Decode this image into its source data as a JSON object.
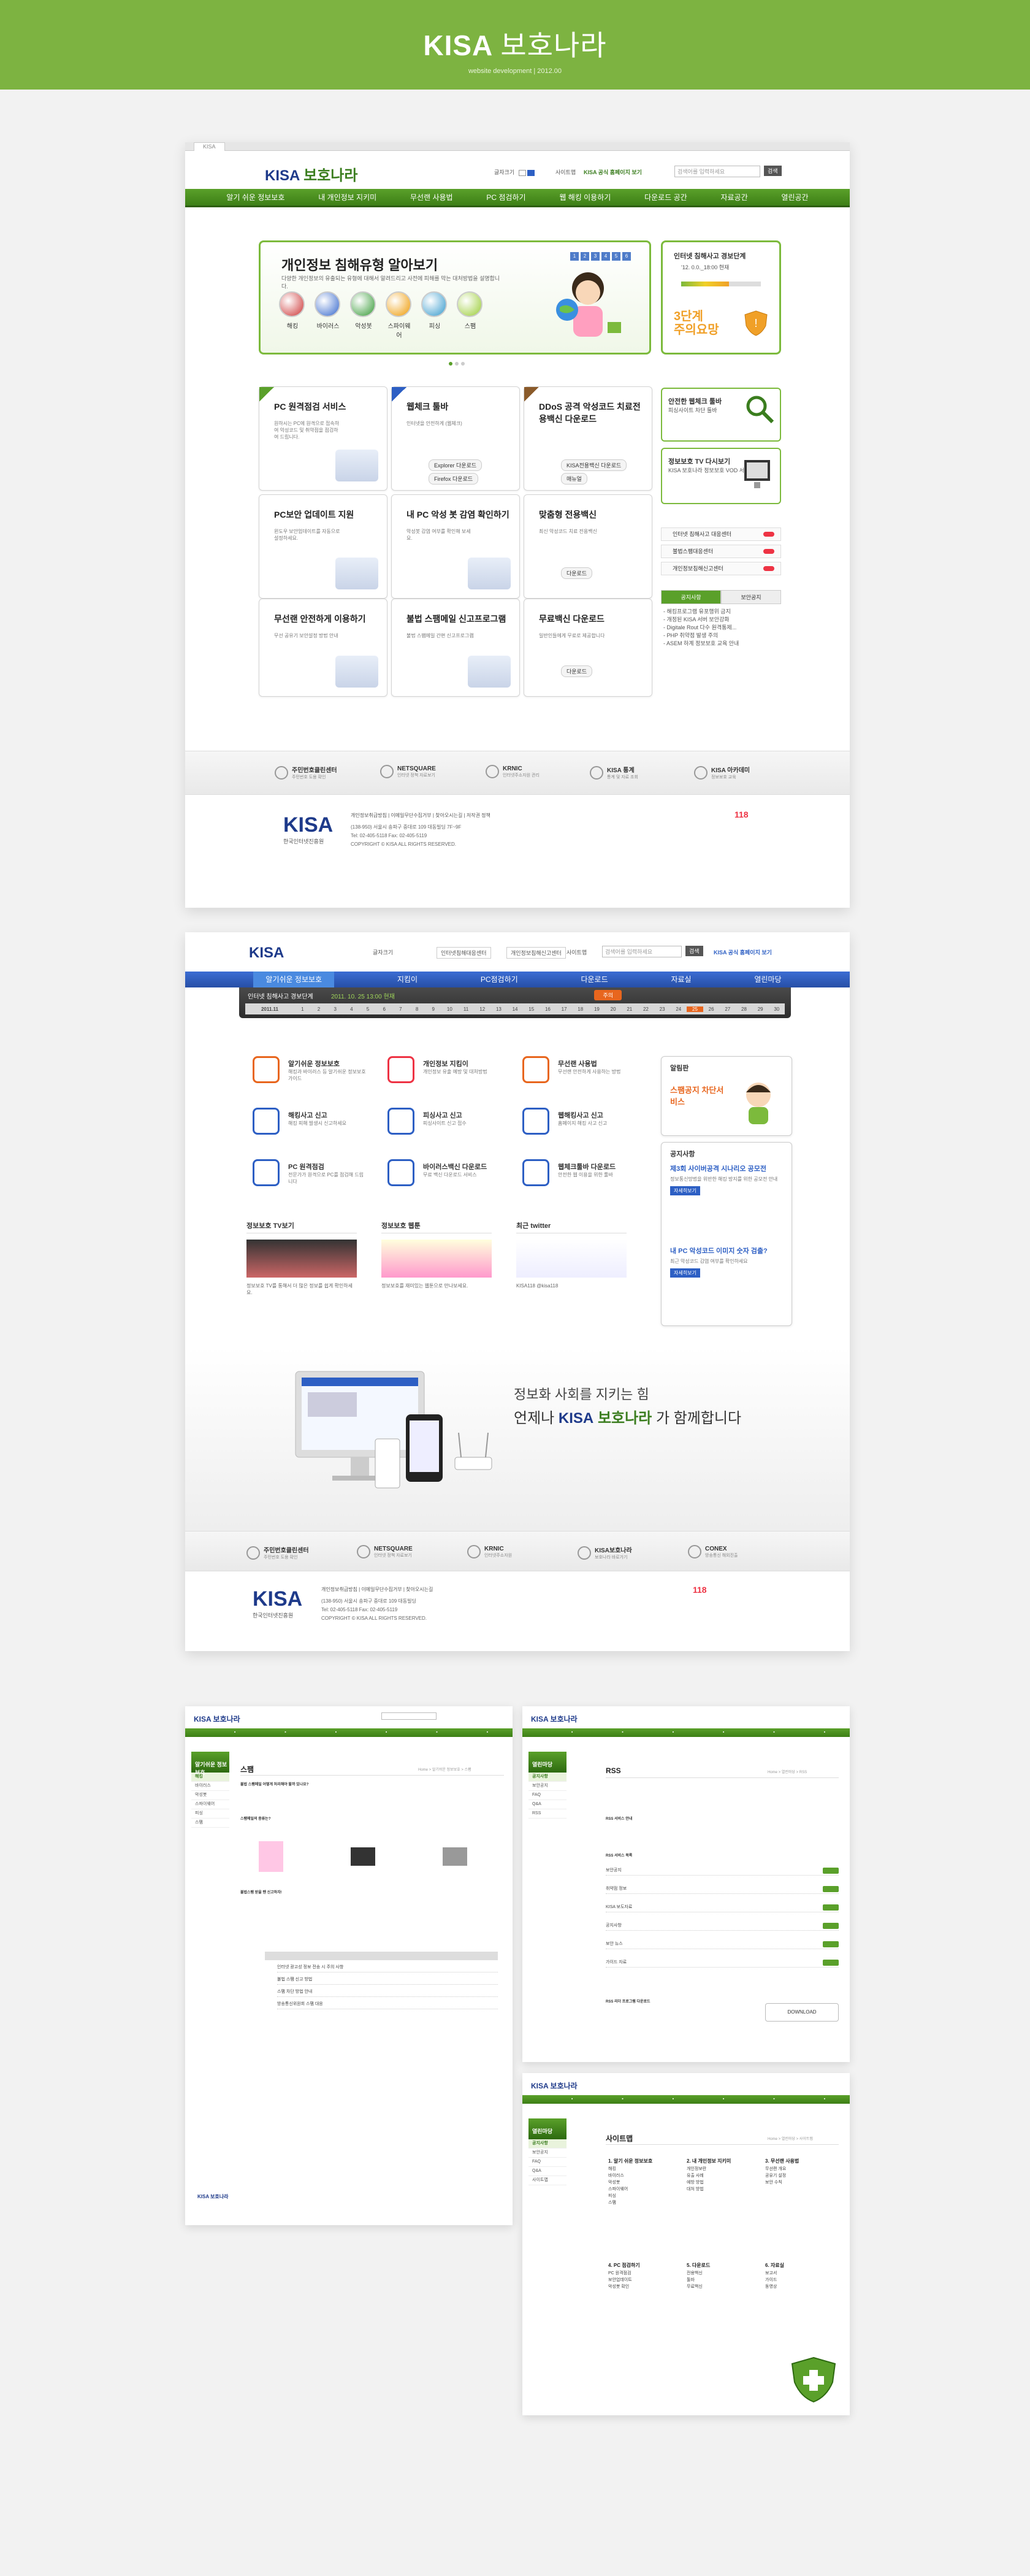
{
  "banner": {
    "title_brand": "KISA",
    "title_kr": "보호나라",
    "subtitle": "website development  |  2012.00"
  },
  "p1": {
    "tab": "KISA",
    "logo_brand": "KISA",
    "logo_kr": "보호나라",
    "font_size_label": "글자크기",
    "sitemap": "사이트맵",
    "kisa_link": "KISA 공식 홈페이지 보기",
    "search_placeholder": "검색어를 입력하세요",
    "search_btn": "검색",
    "gnb": [
      "알기 쉬운 정보보호",
      "내 개인정보 지키미",
      "무선랜 사용법",
      "PC 점검하기",
      "웹 해킹 이용하기",
      "다운로드 공간",
      "자료공간",
      "열린공간"
    ],
    "hero": {
      "title": "개인정보 침해유형 알아보기",
      "desc": "다양한 개인정보의 유출되는 유형에 대해서 알려드리고 사전에 피해를 막는 대처방법을 설명합니다.",
      "pager": [
        "1",
        "2",
        "3",
        "4",
        "5",
        "6"
      ],
      "icons": [
        "해킹",
        "바이러스",
        "악성봇",
        "스파이웨어",
        "피싱",
        "스팸"
      ]
    },
    "side": {
      "title": "인터넷 침해사고 경보단계",
      "desc": "'12. 0.0._18:00 현재",
      "level": "3단계",
      "level_sub": "주의요망"
    },
    "boxes": [
      {
        "title": "PC 원격점검 서비스",
        "desc": "원하시는 PC에 원격으로 접속하여 악성코드 및 취약점을 점검하여 드립니다."
      },
      {
        "title": "웹체크 툴바",
        "desc": "인터넷을 안전하게 (웹체크)",
        "btn1": "Explorer 다운로드",
        "btn2": "Firefox 다운로드"
      },
      {
        "title": "DDoS 공격 악성코드 치료전용백신 다운로드",
        "desc": "",
        "btn1": "KISA전용백신 다운로드",
        "btn2": "매뉴얼"
      },
      {
        "title": "PC보안 업데이트 지원",
        "desc": "윈도우 보안업데이트를 자동으로 설정하세요."
      },
      {
        "title": "내 PC 악성 봇 감염 확인하기",
        "desc": "악성봇 감염 여부를 확인해 보세요."
      },
      {
        "title": "맞춤형 전용백신",
        "desc": "최신 악성코드 치료 전용백신",
        "btn1": "다운로드"
      },
      {
        "title": "무선랜 안전하게 이용하기",
        "desc": "무선 공유기 보안설정 방법 안내"
      },
      {
        "title": "불법 스팸메일 신고프로그램",
        "desc": "불법 스팸메일 간편 신고프로그램"
      },
      {
        "title": "무료백신 다운로드",
        "desc": "일반인들에게 무료로 제공합니다",
        "btn1": "다운로드"
      }
    ],
    "right_boxes": [
      {
        "title": "안전한 웹체크 툴바",
        "desc": "피싱사이트 차단 툴바"
      },
      {
        "title": "정보보호 TV 다시보기",
        "desc": "KISA 보호나라 정보보호 VOD 서비스"
      }
    ],
    "right_list": [
      "인터넷 침해사고 대응센터",
      "불법스팸대응센터",
      "개인정보침해신고센터"
    ],
    "notice": {
      "tabs": [
        "공지사항",
        "보안공지"
      ],
      "items": [
        "- 해킹프로그램 유포행위 금지",
        "- 개정된 KISA 서버 보안강화",
        "- Digitale Rout 다수 원격통제...",
        "- PHP 취약점 발생 주의",
        "- ASEM 하계 정보보호 교육 안내"
      ]
    },
    "partners": [
      {
        "name": "주민번호클린센터",
        "sub": "주민번호 도용 확인"
      },
      {
        "name": "NETSQUARE",
        "sub": "인터넷 정책 자료보기"
      },
      {
        "name": "KRNIC",
        "sub": "인터넷주소자원 관리"
      },
      {
        "name": "KISA 통계",
        "sub": "통계 및 자료 조회"
      },
      {
        "name": "KISA 아카데미",
        "sub": "정보보호 교육"
      }
    ],
    "footer": {
      "logo": "KISA",
      "logo_sub": "한국인터넷진흥원",
      "links": "개인정보취급방침 | 이메일무단수집거부 | 찾아오시는길 | 저작권 정책",
      "addr1": "(138-950) 서울시 송파구 중대로 109 대동빌딩 7F~9F",
      "addr2": "Tel: 02-405-5118  Fax: 02-405-5119",
      "addr3": "COPYRIGHT © KISA ALL RIGHTS RESERVED.",
      "hotline": "118"
    }
  },
  "p2": {
    "logo_brand": "KISA",
    "font_size_label": "글자크기",
    "link1": "인터넷침해대응센터",
    "link2": "개인정보침해신고센터",
    "sitemap": "사이트맵",
    "search_placeholder": "검색어를 입력하세요",
    "search_btn": "검색",
    "kisa_link": "KISA 공식 홈페이지 보기",
    "gnb": [
      "알기쉬운 정보보호",
      "지킴이",
      "PC점검하기",
      "다운로드",
      "자료실",
      "열린마당"
    ],
    "cal_label": "인터넷 침해사고 경보단계",
    "cal_date": "2011. 10. 25  13:00 현재",
    "cal_btn": "주의",
    "cal_month": "2011.11",
    "cal_days": [
      "1",
      "2",
      "3",
      "4",
      "5",
      "6",
      "7",
      "8",
      "9",
      "10",
      "11",
      "12",
      "13",
      "14",
      "15",
      "16",
      "17",
      "18",
      "19",
      "20",
      "21",
      "22",
      "23",
      "24",
      "25",
      "26",
      "27",
      "28",
      "29",
      "30"
    ],
    "services": [
      {
        "title": "알기쉬운 정보보호",
        "desc": "해킹과 바이러스 등 알기쉬운 정보보호 가이드"
      },
      {
        "title": "개인정보 지킴이",
        "desc": "개인정보 유출 예방 및 대처방법"
      },
      {
        "title": "무선랜 사용법",
        "desc": "무선랜 안전하게 사용하는 방법"
      },
      {
        "title": "해킹사고 신고",
        "desc": "해킹 피해 발생시 신고하세요"
      },
      {
        "title": "피싱사고 신고",
        "desc": "피싱사이트 신고 접수"
      },
      {
        "title": "웹해킹사고 신고",
        "desc": "홈페이지 해킹 사고 신고"
      },
      {
        "title": "PC 원격점검",
        "desc": "전문가가 원격으로 PC를 점검해 드립니다"
      },
      {
        "title": "바이러스백신 다운로드",
        "desc": "무료 백신 다운로드 서비스"
      },
      {
        "title": "웹체크툴바 다운로드",
        "desc": "안전한 웹 이용을 위한 툴바"
      }
    ],
    "minis": [
      {
        "title": "정보보호 TV보기",
        "desc": "정보보호 TV를 통해서 더 많은 정보를 쉽게 확인하세요."
      },
      {
        "title": "정보보호 웹툰",
        "desc": "정보보호를 재미있는 웹툰으로 만나보세요."
      },
      {
        "title": "최근 twitter",
        "desc": "KISA118 @kisa118"
      }
    ],
    "login": {
      "title": "알림판",
      "sub": "스팸공지 차단서비스"
    },
    "notice": {
      "title": "공지사항",
      "items": [
        {
          "title": "제3회 사이버공격 시나리오 공모전",
          "desc": "정보통신망법을 위반한 해킹 방지를 위한 공모전 안내",
          "btn": "자세히보기"
        },
        {
          "title": "내 PC 악성코드 이미지 숫자 검출?",
          "desc": "최근 악성코드 감염 여부를 확인하세요",
          "btn": "자세히보기"
        }
      ]
    },
    "promo1": "정보화 사회를 지키는 힘",
    "promo2_pre": "언제나",
    "promo2_brand": "KISA",
    "promo2_kr": "보호나라",
    "promo2_post": "가 함께합니다",
    "partners": [
      {
        "name": "주민번호클린센터",
        "sub": "주민번호 도용 확인"
      },
      {
        "name": "NETSQUARE",
        "sub": "인터넷 정책 자료보기"
      },
      {
        "name": "KRNIC",
        "sub": "인터넷주소자원"
      },
      {
        "name": "KISA보호나라",
        "sub": "보호나라 바로가기"
      },
      {
        "name": "CONEX",
        "sub": "방송통신 해외진출"
      }
    ],
    "footer": {
      "logo": "KISA",
      "logo_sub": "한국인터넷진흥원",
      "links": "개인정보취급방침 | 이메일무단수집거부 | 찾아오시는길",
      "addr1": "(138-950) 서울시 송파구 중대로 109 대동빌딩",
      "addr2": "Tel: 02-405-5118  Fax: 02-405-5119",
      "addr3": "COPYRIGHT © KISA ALL RIGHTS RESERVED.",
      "hotline": "118"
    }
  },
  "sp1": {
    "logo": "KISA 보호나라",
    "lnb_head": "알기쉬운 정보보호",
    "lnb": [
      "해킹",
      "바이러스",
      "악성봇",
      "스파이웨어",
      "피싱",
      "스팸"
    ],
    "title": "스팸",
    "crumb": "Home > 알기쉬운 정보보호 > 스팸",
    "q1": "불법 스팸메일 어떻게 처리해야 할까 있나요?",
    "q2": "스팸메일의 종류는?",
    "q3": "불법스팸 받을 땐 신고하자!",
    "rows": [
      "인터넷 광고성 정보 전송 시 주의 사항",
      "불법 스팸 신고 방법",
      "스팸 차단 방법 안내",
      "방송통신위원회 스팸 대응"
    ]
  },
  "sp2": {
    "logo": "KISA 보호나라",
    "lnb_head": "열린마당",
    "lnb": [
      "공지사항",
      "보안공지",
      "FAQ",
      "Q&A",
      "RSS"
    ],
    "title": "RSS",
    "crumb": "Home > 열린마당 > RSS",
    "s1": "RSS 서비스 안내",
    "s2": "RSS 서비스 목록",
    "rows": [
      "보안공지",
      "취약점 정보",
      "KISA 보도자료",
      "공지사항",
      "보안 뉴스",
      "가이드 자료"
    ],
    "s3": "RSS 리더 프로그램 다운로드",
    "btn": "DOWNLOAD"
  },
  "sp3": {
    "logo": "KISA 보호나라",
    "lnb_head": "열린마당",
    "lnb": [
      "공지사항",
      "보안공지",
      "FAQ",
      "Q&A",
      "사이트맵"
    ],
    "title": "사이트맵",
    "crumb": "Home > 열린마당 > 사이트맵",
    "cols": [
      {
        "head": "1. 알기 쉬운 정보보호",
        "items": [
          "해킹",
          "바이러스",
          "악성봇",
          "스파이웨어",
          "피싱",
          "스팸"
        ]
      },
      {
        "head": "2. 내 개인정보 지키미",
        "items": [
          "개인정보란",
          "유출 사례",
          "예방 방법",
          "대처 방법"
        ]
      },
      {
        "head": "3. 무선랜 사용법",
        "items": [
          "무선랜 개요",
          "공유기 설정",
          "보안 수칙"
        ]
      },
      {
        "head": "4. PC 점검하기",
        "items": [
          "PC 원격점검",
          "보안업데이트",
          "악성봇 확인"
        ]
      },
      {
        "head": "5. 다운로드",
        "items": [
          "전용백신",
          "툴바",
          "무료백신"
        ]
      },
      {
        "head": "6. 자료실",
        "items": [
          "보고서",
          "가이드",
          "동영상"
        ]
      }
    ]
  }
}
